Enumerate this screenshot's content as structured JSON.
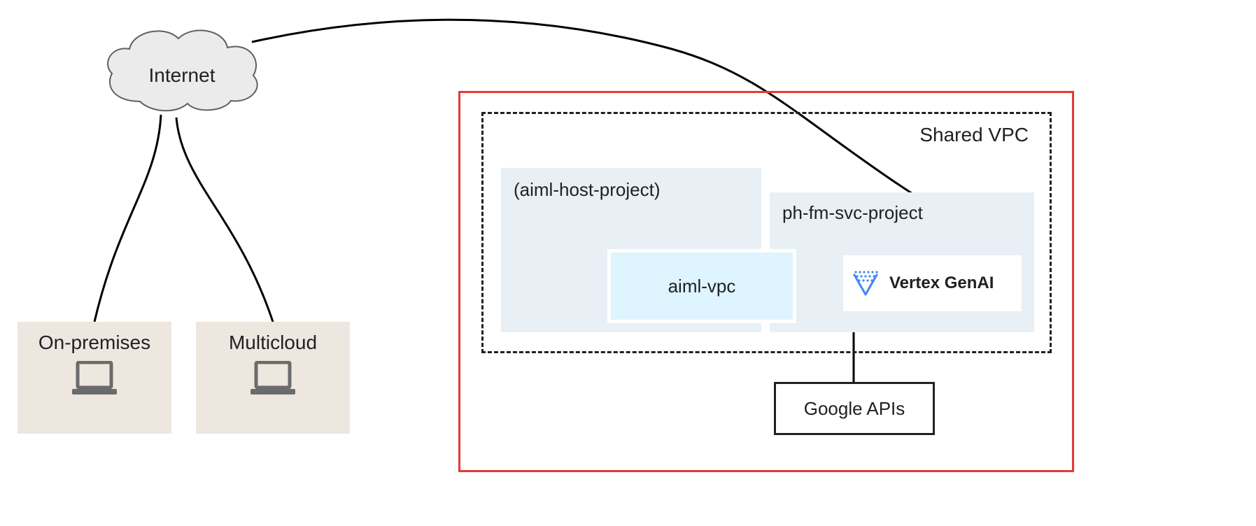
{
  "cloud": {
    "label": "Internet"
  },
  "on_premises": {
    "label": "On-premises"
  },
  "multicloud": {
    "label": "Multicloud"
  },
  "shared_vpc": {
    "label": "Shared VPC"
  },
  "host_project": {
    "label": "(aiml-host-project)"
  },
  "svc_project": {
    "label": "ph-fm-svc-project"
  },
  "aiml_vpc": {
    "label": "aiml-vpc"
  },
  "vertex": {
    "label": "Vertex GenAI"
  },
  "google_apis": {
    "label": "Google APIs"
  }
}
